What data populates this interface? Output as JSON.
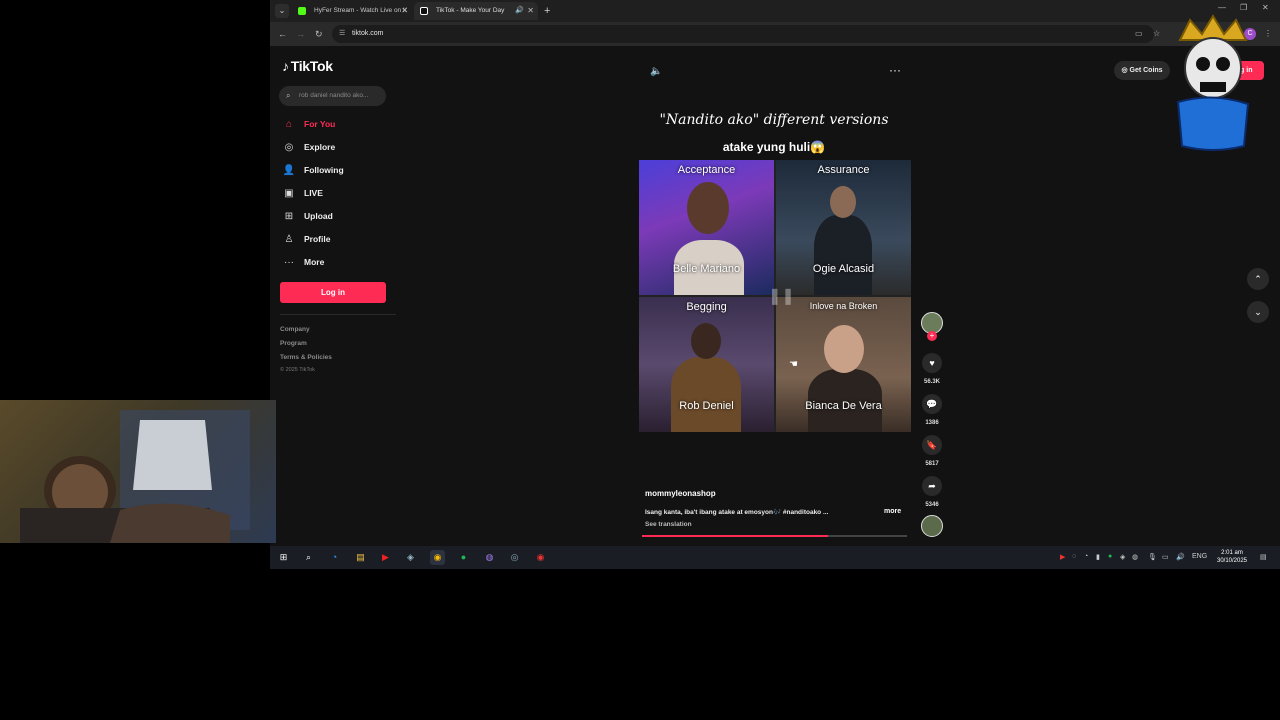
{
  "browser": {
    "tabs": [
      {
        "title": "HyFer Stream - Watch Live on K",
        "active": false
      },
      {
        "title": "TikTok - Make Your Day",
        "active": true
      }
    ],
    "url": "tiktok.com"
  },
  "tiktok": {
    "logo": "TikTok",
    "search_placeholder": "rob daniel nandito ako...",
    "nav": [
      {
        "label": "For You",
        "icon": "home-icon",
        "active": true
      },
      {
        "label": "Explore",
        "icon": "compass-icon"
      },
      {
        "label": "Following",
        "icon": "following-icon"
      },
      {
        "label": "LIVE",
        "icon": "live-icon"
      },
      {
        "label": "Upload",
        "icon": "upload-icon"
      },
      {
        "label": "Profile",
        "icon": "profile-icon"
      },
      {
        "label": "More",
        "icon": "more-icon"
      }
    ],
    "login_label": "Log in",
    "footer": {
      "company": "Company",
      "program": "Program",
      "terms": "Terms & Policies",
      "copyright": "© 2025 TikTok"
    },
    "top": {
      "get_coins": "Get Coins",
      "login": "Log in"
    },
    "video": {
      "title": "\"Nandito ako\" different versions",
      "subtitle": "atake yung huli😱",
      "cells": [
        {
          "top": "Acceptance",
          "bottom": "Belle Mariano"
        },
        {
          "top": "Assurance",
          "bottom": "Ogie Alcasid"
        },
        {
          "top": "Begging",
          "bottom": "Rob Deniel"
        },
        {
          "top": "Inlove na Broken",
          "bottom": "Bianca De Vera"
        }
      ],
      "author": "mommyleonashop",
      "caption": "Isang kanta, iba't ibang atake at emosyon🎶 #nanditoako ...",
      "caption_more": "more",
      "see_translation": "See translation",
      "progress": 0.7
    },
    "actions": {
      "likes": "56.3K",
      "comments": "1386",
      "saves": "5817",
      "shares": "5346"
    }
  },
  "taskbar": {
    "time": "2:01 am",
    "date": "30/10/2025",
    "lang": "ENG"
  }
}
